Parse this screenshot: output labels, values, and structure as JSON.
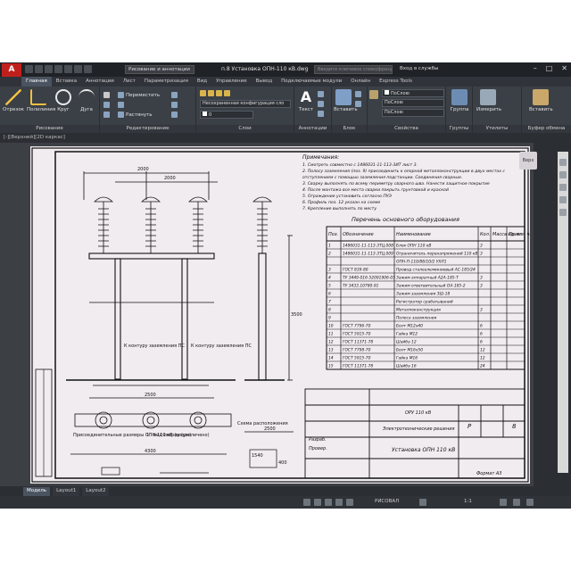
{
  "titlebar": {
    "workspace": "Рисование и аннотации",
    "document": "п.8 Установка ОПН-110 кВ.dwg",
    "search_placeholder": "Введите ключевое слово/фразу",
    "signin": "Вход в службы"
  },
  "ribbon_tabs": [
    "Главная",
    "Вставка",
    "Аннотации",
    "Лист",
    "Параметризация",
    "Вид",
    "Управление",
    "Вывод",
    "Подключаемые модули",
    "Онлайн",
    "Express Tools"
  ],
  "ribbon": {
    "draw": {
      "title": "Рисование",
      "tools": [
        "Отрезок",
        "Полилиния",
        "Круг",
        "Дуга"
      ]
    },
    "modify": {
      "title": "Редактирование",
      "move": "Переместить",
      "stretch": "Растянуть"
    },
    "layers": {
      "title": "Слои",
      "layer_state": "Несохраненная конфигурация сло",
      "current_layer": "0"
    },
    "annotation": {
      "title": "Аннотации",
      "text": "Текст"
    },
    "block": {
      "title": "Блок",
      "insert": "Вставить"
    },
    "properties": {
      "title": "Свойства",
      "layer_field": "ПоСлою",
      "color_field": "ПоСлою",
      "linetype_field": "ПоСлою"
    },
    "groups": {
      "title": "Группы",
      "group": "Группа"
    },
    "utilities": {
      "title": "Утилиты",
      "measure": "Измерить"
    },
    "clipboard": {
      "title": "Буфер обмена",
      "paste": "Вставить"
    }
  },
  "view_label": "[-][Верхний][2D каркас]",
  "viewcube_label": "Верх",
  "layout_tabs": [
    "Модель",
    "Layout1",
    "Layout2"
  ],
  "status": {
    "mode": "РИСОВАЛ",
    "scale": "1:1"
  },
  "drawing": {
    "notes_title": "Примечания:",
    "notes": [
      "1. Смотреть совместно с 1486031-11-113-3ИТ лист 3.",
      "2. Полосу заземления (поз. 9) присоединить к опорной металлоконструкции в двух местах с",
      "отступлением с помощью заземления подстанции. Соединения сварные.",
      "3. Сварку выполнять по всему периметру сварного шва. Нанести защитное покрытие",
      "4. После монтажа все места сварки покрыть грунтовкой и краской",
      "5. Ограждение установить согласно ПУЭ",
      "6. Профиль поз. 12 указан на схеме",
      "7. Крепление выполнять по месту"
    ],
    "spec_title": "Перечень основного оборудования",
    "spec_headers": [
      "Поз.",
      "Обозначение",
      "Наименование",
      "Кол.",
      "Масса ед. кг",
      "Приме- чание"
    ],
    "spec_rows": [
      [
        "1",
        "1486031-11-113-3ТЦ.008",
        "Блок ОПН 110 кВ",
        "3",
        "",
        ""
      ],
      [
        "2",
        "1486031-11-113-3ТЦ.009",
        "Ограничитель перенапряжений 110 кВ",
        "3",
        "",
        ""
      ],
      [
        "",
        "",
        "ОПН-П-110/88/10/2 УХЛ1",
        "",
        "",
        ""
      ],
      [
        "3",
        "ГОСТ 839-80",
        "Провод сталеалюминиевый АС-185/24",
        "",
        "",
        ""
      ],
      [
        "4",
        "ТУ 3449-016-52091906-05",
        "Зажим аппаратный А2А-185-Т",
        "3",
        "",
        ""
      ],
      [
        "5",
        "ТУ 3433.10780-91",
        "Зажим ответвительный ОА-185-2",
        "3",
        "",
        ""
      ],
      [
        "6",
        "",
        "Зажим заземления ЗШ-18",
        "",
        "",
        ""
      ],
      [
        "7",
        "",
        "Регистратор срабатываний",
        "",
        "",
        ""
      ],
      [
        "8",
        "",
        "Металлоконструкция",
        "3",
        "",
        ""
      ],
      [
        "9",
        "",
        "Полоса заземления",
        "",
        "",
        ""
      ],
      [
        "10",
        "ГОСТ 7796-70",
        "Болт М12х40",
        "6",
        "",
        ""
      ],
      [
        "11",
        "ГОСТ 5915-70",
        "Гайка М12",
        "6",
        "",
        ""
      ],
      [
        "12",
        "ГОСТ 11371-78",
        "Шайба 12",
        "6",
        "",
        ""
      ],
      [
        "13",
        "ГОСТ 7798-70",
        "Болт М16х50",
        "12",
        "",
        ""
      ],
      [
        "14",
        "ГОСТ 5915-70",
        "Гайка М16",
        "12",
        "",
        ""
      ],
      [
        "15",
        "ГОСТ 11371-78",
        "Шайба 16",
        "24",
        "",
        ""
      ]
    ],
    "dims": {
      "d2000a": "2000",
      "d2000b": "2000",
      "d2500": "2500",
      "d4300": "4300",
      "d3500": "3500",
      "d2500b": "2500",
      "d400": "400",
      "d1540": "1540"
    },
    "labels": {
      "ground_a": "К контуру заземления ПС",
      "ground_b": "К контуру заземления ПС",
      "inset_a": "Присоединительные размеры ОПН-110 кВ (вверх)",
      "inset_b": "1 - вид сверху (увеличено)",
      "inset_c": "Схема расположения",
      "stamp_code": "ОРУ 110 кВ",
      "stamp_title": "Установка ОПН 110 кВ",
      "stamp_sub": "Электротехнические решения",
      "stamp_stage": "Р",
      "stamp_sheet": "8",
      "stamp_format": "Формат А3"
    },
    "title_block": {
      "developer": "Разраб.",
      "checked": "Провер."
    }
  }
}
